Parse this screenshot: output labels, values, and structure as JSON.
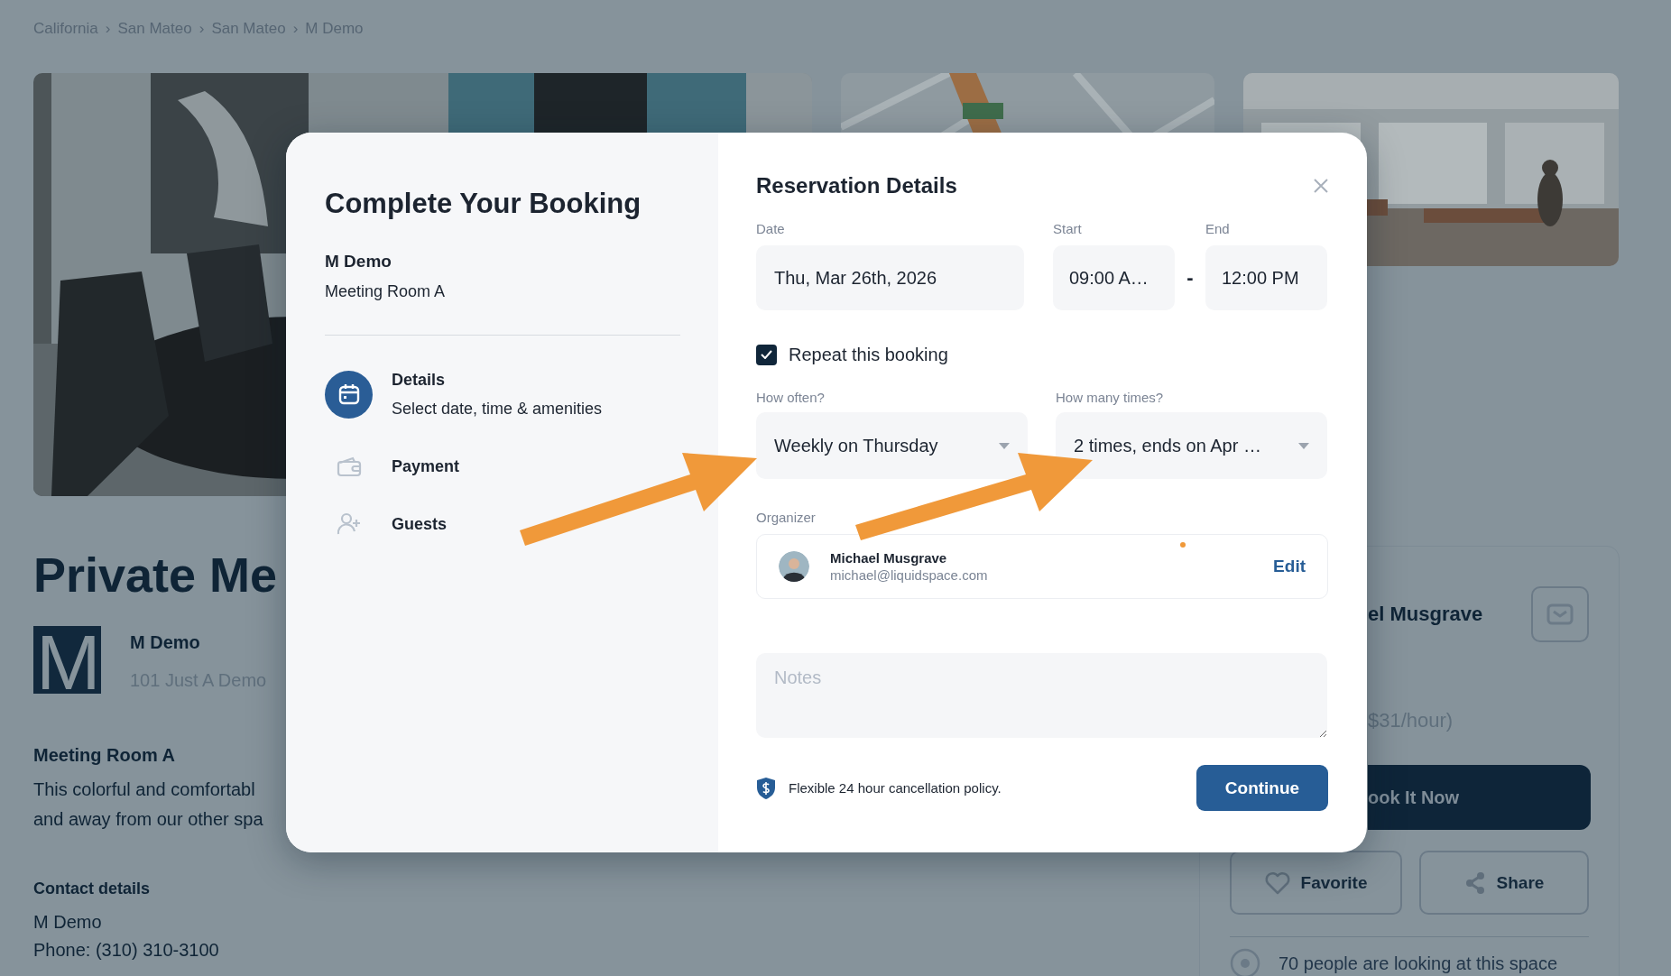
{
  "breadcrumbs": {
    "separator": "›",
    "items": [
      "California",
      "San Mateo",
      "San Mateo",
      "M Demo"
    ]
  },
  "listing": {
    "title": "Private Me",
    "logo": "M",
    "host_name": "M Demo",
    "address": "101 Just A Demo",
    "room_heading": "Meeting Room A",
    "description": [
      "This colorful and comfortabl",
      "and away from our other spa"
    ],
    "contact_heading": "Contact details",
    "contact_lines": [
      "M Demo",
      "Phone: (310) 310-3100"
    ]
  },
  "host_card": {
    "host_name": "el Musgrave",
    "price": "$31/hour)",
    "book": "ook It Now",
    "favorite": "Favorite",
    "share": "Share",
    "viewers": "70 people are looking at this space"
  },
  "booking": {
    "title": "Complete Your Booking",
    "venue": "M Demo",
    "room": "Meeting Room A",
    "steps": [
      {
        "kind": "calendar",
        "title": "Details",
        "subtitle": "Select date, time & amenities",
        "selected": true
      },
      {
        "kind": "wallet",
        "title": "Payment",
        "selected": false
      },
      {
        "kind": "guests",
        "title": "Guests",
        "selected": false
      }
    ],
    "details": {
      "title": "Reservation Details",
      "date_label": "Date",
      "date": "Thu, Mar 26th, 2026",
      "start_label": "Start",
      "start": "09:00 A…",
      "separator": "-",
      "end_label": "End",
      "end": "12:00 PM",
      "repeat": {
        "label": "Repeat this booking",
        "checked": true
      },
      "frequency": {
        "label": "How often?",
        "value": "Weekly on Thursday"
      },
      "count": {
        "label": "How many times?",
        "value": "2 times, ends on Apr …"
      },
      "organizer": {
        "label": "Organizer",
        "name": "Michael Musgrave",
        "email": "michael@liquidspace.com",
        "action": "Edit"
      },
      "notes": {
        "placeholder": "Notes"
      },
      "policy": "Flexible 24 hour cancellation policy.",
      "continue": "Continue"
    }
  }
}
